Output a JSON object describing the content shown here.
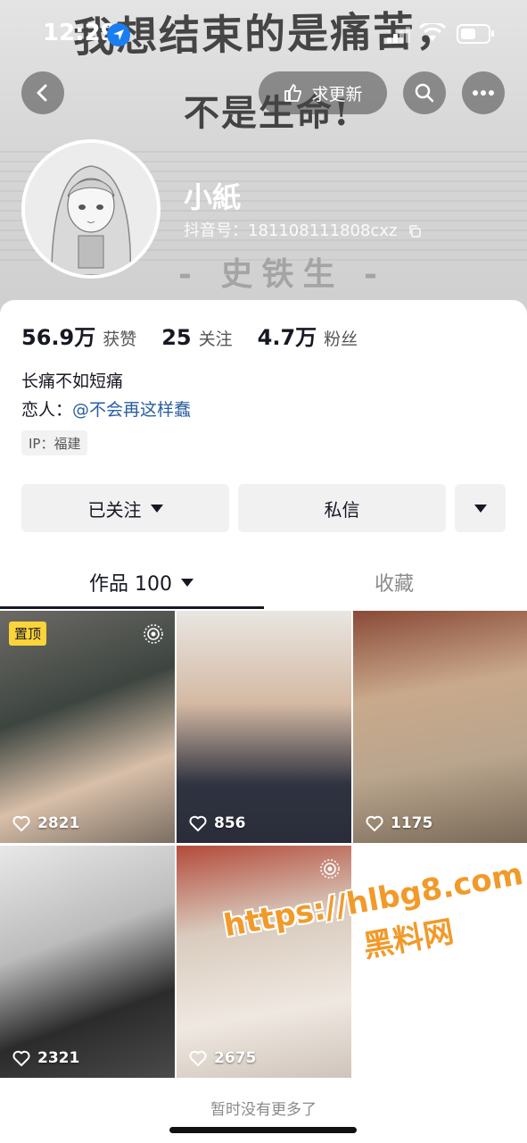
{
  "status_bar": {
    "time": "12:29"
  },
  "banner": {
    "line1": "我想结束的是痛苦，",
    "line2": "不是生命!",
    "signature": "- 史铁生 -"
  },
  "top_bar": {
    "update_label": "求更新"
  },
  "profile": {
    "nickname": "小紙",
    "douyin_id": "抖音号：181108111808cxz"
  },
  "stats": [
    {
      "value": "56.9万",
      "label": "获赞"
    },
    {
      "value": "25",
      "label": "关注"
    },
    {
      "value": "4.7万",
      "label": "粉丝"
    }
  ],
  "bio": {
    "line1": "长痛不如短痛",
    "lover_prefix": "恋人：",
    "lover_mention": "@不会再这样蠢"
  },
  "ip": "IP：福建",
  "actions": {
    "follow": "已关注",
    "message": "私信"
  },
  "tabs": {
    "works": "作品 100",
    "favorites": "收藏"
  },
  "videos": [
    {
      "likes": "2821",
      "pinned": "置顶"
    },
    {
      "likes": "856"
    },
    {
      "likes": "1175"
    },
    {
      "likes": "2321"
    },
    {
      "likes": "2675"
    }
  ],
  "watermark": {
    "url": "https://hlbg8.com",
    "text": "黑料网"
  },
  "footer": {
    "no_more": "暂时没有更多了"
  },
  "colors": {
    "pinned_bg": "#fbd33a",
    "mention": "#2a5ea0",
    "watermark": "#f19a2a",
    "location": "#1a7ef2"
  }
}
